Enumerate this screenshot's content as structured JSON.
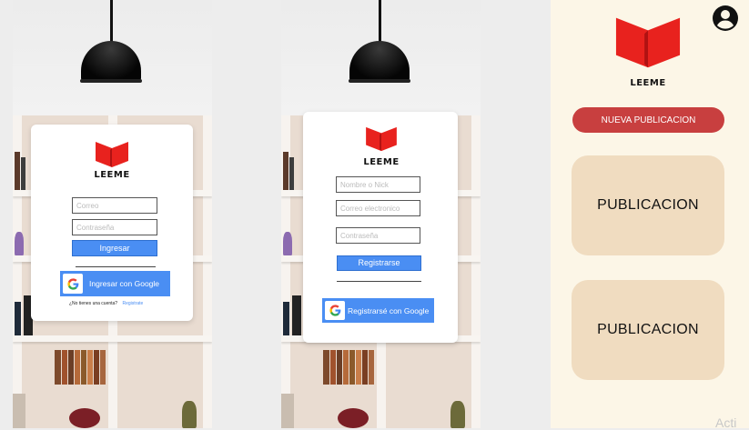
{
  "brand": "LEEME",
  "login": {
    "email_placeholder": "Correo",
    "password_placeholder": "Contraseña",
    "submit_label": "Ingresar",
    "google_label": "Ingresar con Google",
    "signup_prompt": "¿No tienes una cuenta?",
    "signup_link": "Registrate"
  },
  "register": {
    "nick_placeholder": "Nombre o Nick",
    "email_placeholder": "Correo electronico",
    "password_placeholder": "Contraseña",
    "submit_label": "Registrarse",
    "google_label": "Registrarsé con Google"
  },
  "feed": {
    "new_post_label": "NUEVA PUBLICACION",
    "posts": [
      {
        "label": "PUBLICACION"
      },
      {
        "label": "PUBLICACION"
      }
    ]
  },
  "watermark": "Acti",
  "icons": {
    "logo": "open-book-icon",
    "profile": "user-circle-icon",
    "google": "google-g-icon"
  },
  "colors": {
    "logo_red": "#e8221e",
    "primary_blue": "#4a8ef3",
    "new_post_red": "#c83f3f",
    "feed_background": "#fcf6e7",
    "post_card": "#f0dcc0"
  }
}
